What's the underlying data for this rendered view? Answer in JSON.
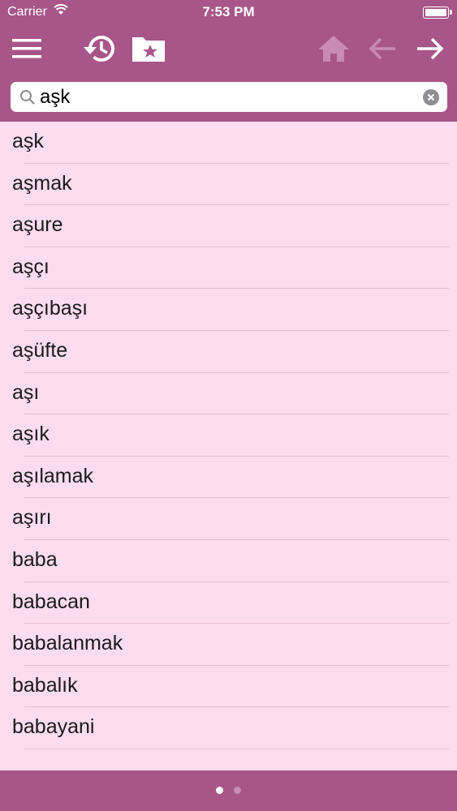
{
  "status_bar": {
    "carrier": "Carrier",
    "time": "7:53 PM"
  },
  "toolbar": {
    "icons": [
      "menu-icon",
      "history-icon",
      "favorites-folder-icon",
      "home-icon",
      "back-arrow-icon",
      "forward-arrow-icon"
    ],
    "disabled_color": "#c98bb5",
    "active_color": "#ffffff"
  },
  "search": {
    "value": "aşk"
  },
  "words": [
    "aşk",
    "aşmak",
    "aşure",
    "aşçı",
    "aşçıbaşı",
    "aşüfte",
    "aşı",
    "aşık",
    "aşılamak",
    "aşırı",
    "baba",
    "babacan",
    "babalanmak",
    "babalık",
    "babayani"
  ],
  "page_indicator": {
    "pages": 2,
    "current": 1
  },
  "colors": {
    "header": "#a85589",
    "list_background": "#fddcf0",
    "separator": "#e6bcd5"
  }
}
